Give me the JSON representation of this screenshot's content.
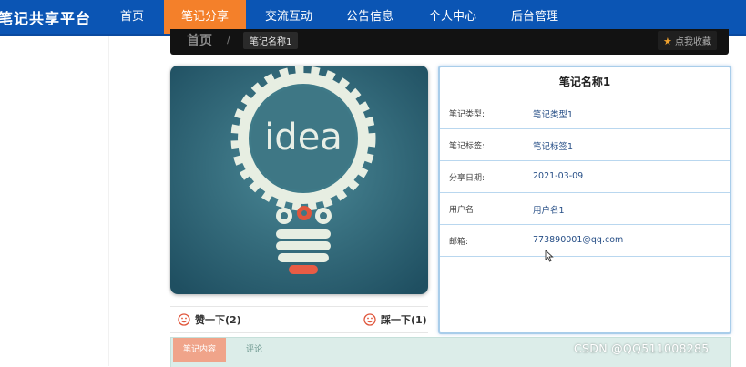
{
  "nav": {
    "brand": "笔记共享平台",
    "items": [
      {
        "label": "首页",
        "active": false
      },
      {
        "label": "笔记分享",
        "active": true
      },
      {
        "label": "交流互动",
        "active": false
      },
      {
        "label": "公告信息",
        "active": false
      },
      {
        "label": "个人中心",
        "active": false
      },
      {
        "label": "后台管理",
        "active": false
      }
    ]
  },
  "breadcrumb": {
    "home": "首页",
    "separator": "/",
    "current": "笔记名称1"
  },
  "favorite": {
    "label": "点我收藏",
    "icon": "star-icon"
  },
  "image": {
    "text": "idea"
  },
  "votes": {
    "like": "赞一下(2)",
    "dislike": "踩一下(1)"
  },
  "detail": {
    "title": "笔记名称1",
    "rows": [
      {
        "label": "笔记类型:",
        "value": "笔记类型1"
      },
      {
        "label": "笔记标签:",
        "value": "笔记标签1"
      },
      {
        "label": "分享日期:",
        "value": "2021-03-09"
      },
      {
        "label": "用户名:",
        "value": "用户名1"
      },
      {
        "label": "邮箱:",
        "value": "773890001@qq.com"
      }
    ]
  },
  "tabs": [
    {
      "label": "笔记内容",
      "active": true
    },
    {
      "label": "评论",
      "active": false
    }
  ],
  "watermark": "CSDN @QQ511008285",
  "colors": {
    "nav_bg": "#0b55b4",
    "nav_active": "#f4802a",
    "crumb_bg": "#121212",
    "panel_border": "#a9cdea",
    "tab_active": "#f0a48a"
  }
}
